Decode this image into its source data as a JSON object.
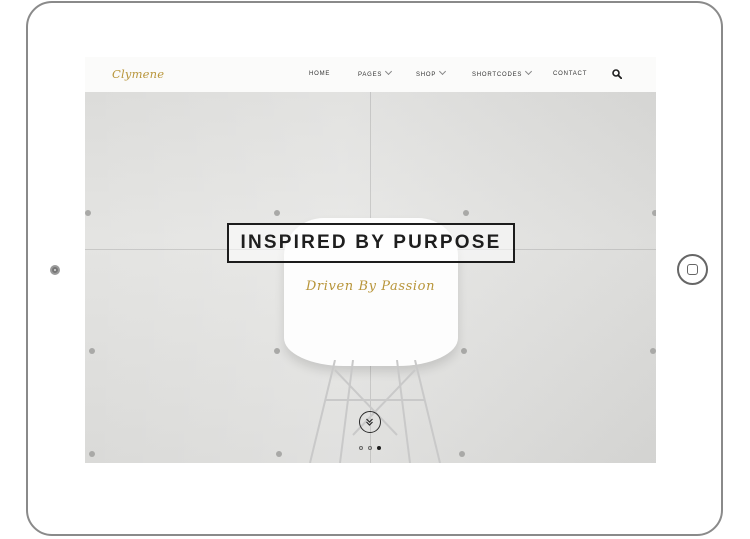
{
  "site": {
    "logo": "Clymene"
  },
  "nav": {
    "items": [
      {
        "label": "HOME",
        "has_dropdown": false
      },
      {
        "label": "PAGES",
        "has_dropdown": true
      },
      {
        "label": "SHOP",
        "has_dropdown": true
      },
      {
        "label": "SHORTCODES",
        "has_dropdown": true
      },
      {
        "label": "CONTACT",
        "has_dropdown": false
      }
    ],
    "search_icon": "search-icon"
  },
  "hero": {
    "headline": "INSPIRED BY PURPOSE",
    "subheadline": "Driven By Passion",
    "scroll_icon": "chevron-double-down-icon",
    "slides": 3,
    "active_slide": 3
  },
  "colors": {
    "accent": "#b8953a",
    "text_dark": "#1e1e1e"
  }
}
